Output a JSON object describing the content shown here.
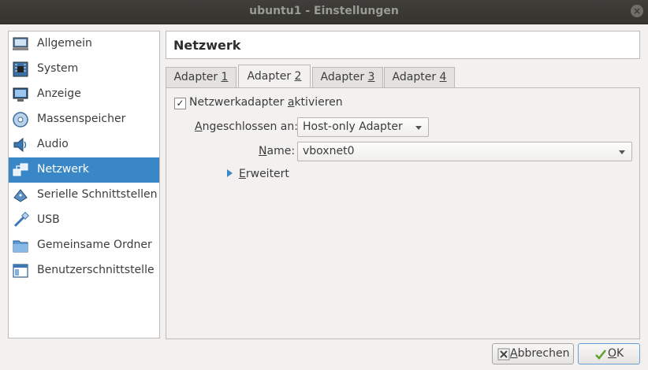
{
  "window": {
    "title": "ubuntu1 - Einstellungen",
    "close_glyph": "×"
  },
  "sidebar": {
    "items": [
      {
        "label": "Allgemein",
        "icon": "computer-icon"
      },
      {
        "label": "System",
        "icon": "chip-icon"
      },
      {
        "label": "Anzeige",
        "icon": "monitor-icon"
      },
      {
        "label": "Massenspeicher",
        "icon": "disk-icon"
      },
      {
        "label": "Audio",
        "icon": "speaker-icon"
      },
      {
        "label": "Netzwerk",
        "icon": "network-icon",
        "selected": true
      },
      {
        "label": "Serielle Schnittstellen",
        "icon": "serial-port-icon"
      },
      {
        "label": "USB",
        "icon": "usb-icon"
      },
      {
        "label": "Gemeinsame Ordner",
        "icon": "folder-icon"
      },
      {
        "label": "Benutzerschnittstelle",
        "icon": "window-icon"
      }
    ]
  },
  "main": {
    "title": "Netzwerk",
    "tabs": [
      {
        "label": "Adapter ",
        "mnemonic": "1"
      },
      {
        "label": "Adapter ",
        "mnemonic": "2",
        "active": true
      },
      {
        "label": "Adapter ",
        "mnemonic": "3"
      },
      {
        "label": "Adapter ",
        "mnemonic": "4"
      }
    ],
    "enable_adapter": {
      "label_pre": "Netzwerkadapter ",
      "mnemonic": "a",
      "label_post": "ktivieren",
      "checked": "✓"
    },
    "attached_to": {
      "label_mnemonic": "A",
      "label_rest": "ngeschlossen an:",
      "value": "Host-only Adapter"
    },
    "name": {
      "label_mnemonic": "N",
      "label_rest": "ame:",
      "value": "vboxnet0"
    },
    "advanced": {
      "mnemonic": "E",
      "label_rest": "rweitert"
    }
  },
  "buttons": {
    "cancel": {
      "mnemonic": "A",
      "label_rest": "bbrechen"
    },
    "ok": {
      "mnemonic": "O",
      "label_rest": "K"
    }
  },
  "colors": {
    "selection": "#3a87c8",
    "titlebar": "#3a3935"
  }
}
